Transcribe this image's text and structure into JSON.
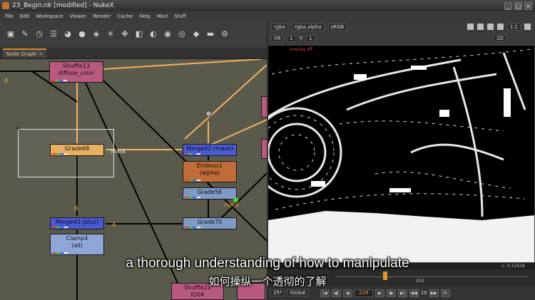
{
  "window": {
    "title": "23_Begin.nk [modified] - NukeX",
    "buttons": [
      "_",
      "□",
      "×"
    ]
  },
  "menu": [
    "File",
    "Edit",
    "Workspace",
    "Viewer",
    "Render",
    "Cache",
    "Help",
    "Mari",
    "Stuff"
  ],
  "toolbar_icons": [
    "pointer-icon",
    "brush-icon",
    "clock-icon",
    "stack-icon",
    "palette-icon",
    "circle-icon",
    "layers-icon",
    "star-burst-icon",
    "move-icon",
    "cube-icon",
    "eye-drop-icon",
    "disc-icon",
    "eye-icon",
    "tag-icon",
    "folder-icon",
    "gear-icon"
  ],
  "graph": {
    "tab_label": "Node Graph",
    "nodes": {
      "shuffle13": [
        "Shuffle13",
        "diffuse_color"
      ],
      "grade68": "Grade68",
      "merge42": "Merge42 (mask)",
      "emboss1": [
        "Emboss1",
        "(alpha)"
      ],
      "grade56": "Grade56",
      "grade70": "Grade70",
      "merge43": "Merge43 (plus)",
      "clamp4": [
        "Clamp4",
        "(all)"
      ],
      "shuffle22": [
        "Shuffle22",
        "ID04"
      ]
    },
    "labels": {
      "mask1": "mask",
      "mask2": "mask",
      "b1": "B",
      "b2": "B",
      "a1": "A"
    }
  },
  "viewer": {
    "row1": {
      "channels": "rgba",
      "alpha": "rgba.alpha",
      "colorspace": "sRGB",
      "zoom": "1:1"
    },
    "row2": {
      "fstop": "f/8",
      "frame_label": "1",
      "y_label": "Y",
      "y_value": "1",
      "view": "2D"
    },
    "overlay": "overlay off",
    "info": "L: 0.12634",
    "timeline_marks": [
      "250"
    ],
    "current_frame": "228",
    "fps": "25*",
    "scope": "Global",
    "step": "10"
  },
  "subtitles": {
    "en": "a thorough understanding of how to manipulate",
    "zh": "如何操纵一个透彻的了解"
  }
}
